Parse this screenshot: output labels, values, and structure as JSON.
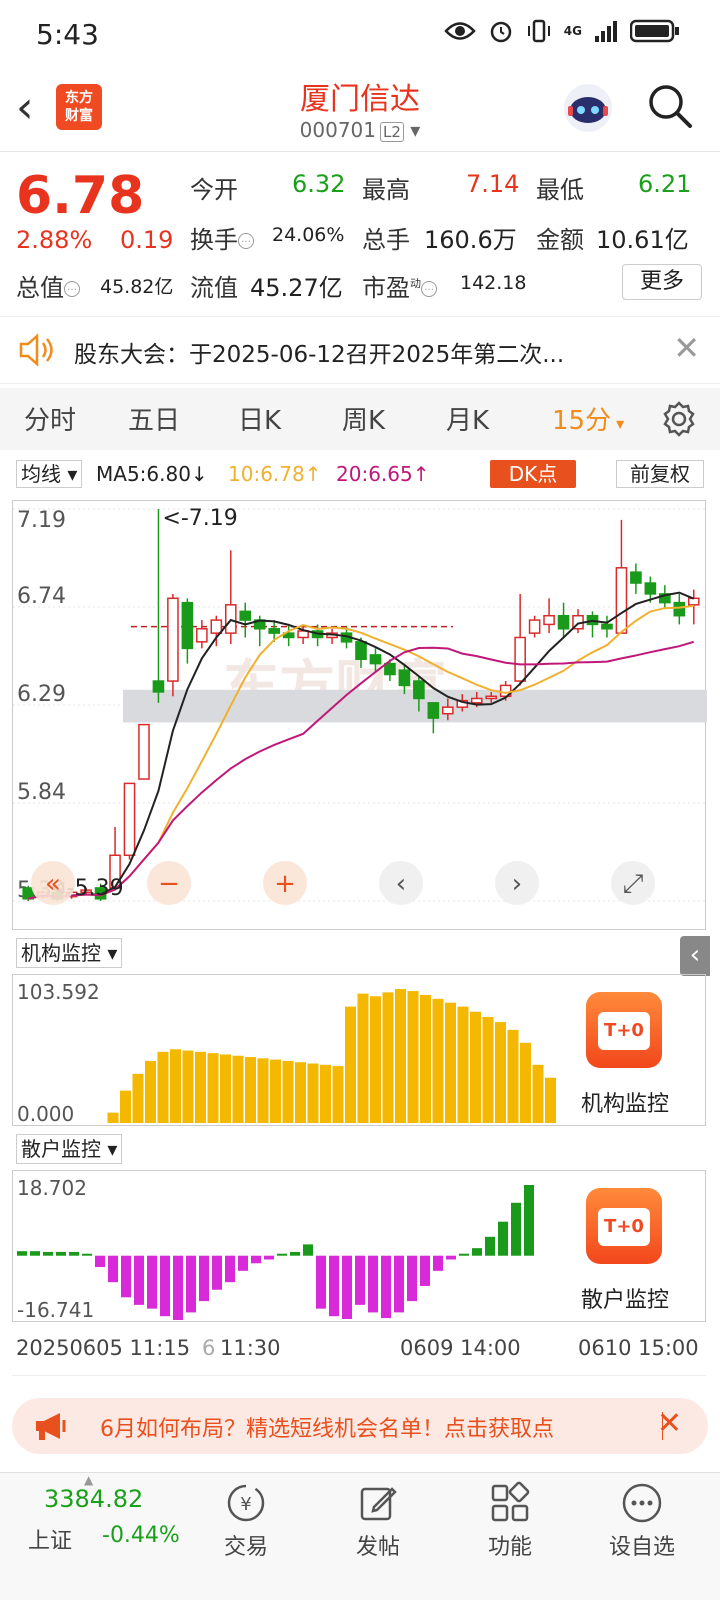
{
  "status": {
    "time": "5:43",
    "net": "4G"
  },
  "header": {
    "logo": "东方\n财富",
    "title": "厦门信达",
    "code": "000701",
    "level": "L2"
  },
  "quote": {
    "price": "6.78",
    "pct": "2.88%",
    "change": "0.19",
    "open_label": "今开",
    "open": "6.32",
    "high_label": "最高",
    "high": "7.14",
    "low_label": "最低",
    "low": "6.21",
    "turnover_label": "换手",
    "turnover": "24.06%",
    "volume_label": "总手",
    "volume": "160.6万",
    "amount_label": "金额",
    "amount": "10.61亿",
    "mcap_label": "总值",
    "mcap": "45.82亿",
    "float_label": "流值",
    "float": "45.27亿",
    "pe_label": "市盈",
    "pe_sup": "动",
    "pe": "142.18",
    "more": "更多"
  },
  "notice": {
    "text": "股东大会：于2025-06-12召开2025年第二次..."
  },
  "tabs": [
    "分时",
    "五日",
    "日K",
    "周K",
    "月K",
    "15分"
  ],
  "ma": {
    "mode": "均线",
    "ma5": "MA5:6.80↓",
    "ma10": "10:6.78↑",
    "ma20": "20:6.65↑",
    "dk": "DK点",
    "fq": "前复权"
  },
  "kline": {
    "y_labels": [
      "7.19",
      "6.74",
      "6.29",
      "5.84",
      "5.39"
    ],
    "high_marker": "<-7.19",
    "low_marker": "<-5.39",
    "watermark": "东方财富",
    "ylim": [
      5.39,
      7.19
    ],
    "candles": [
      [
        5.45,
        5.4,
        5.46,
        5.39
      ],
      [
        5.41,
        5.43,
        5.44,
        5.4
      ],
      [
        5.43,
        5.4,
        5.44,
        5.39
      ],
      [
        5.41,
        5.43,
        5.44,
        5.4
      ],
      [
        5.43,
        5.44,
        5.45,
        5.42
      ],
      [
        5.45,
        5.4,
        5.47,
        5.39
      ],
      [
        5.45,
        5.6,
        5.73,
        5.44
      ],
      [
        5.6,
        5.93,
        5.93,
        5.58
      ],
      [
        5.95,
        6.2,
        6.2,
        5.95
      ],
      [
        6.4,
        6.35,
        7.19,
        6.3
      ],
      [
        6.4,
        6.78,
        6.8,
        6.33
      ],
      [
        6.76,
        6.55,
        6.78,
        6.48
      ],
      [
        6.58,
        6.64,
        6.68,
        6.55
      ],
      [
        6.62,
        6.68,
        6.7,
        6.56
      ],
      [
        6.62,
        6.75,
        7.0,
        6.57
      ],
      [
        6.72,
        6.68,
        6.76,
        6.6
      ],
      [
        6.68,
        6.64,
        6.7,
        6.56
      ],
      [
        6.64,
        6.62,
        6.68,
        6.58
      ],
      [
        6.62,
        6.6,
        6.66,
        6.56
      ],
      [
        6.6,
        6.63,
        6.66,
        6.57
      ],
      [
        6.63,
        6.6,
        6.66,
        6.56
      ],
      [
        6.6,
        6.62,
        6.64,
        6.57
      ],
      [
        6.62,
        6.58,
        6.65,
        6.55
      ],
      [
        6.58,
        6.5,
        6.6,
        6.46
      ],
      [
        6.52,
        6.48,
        6.55,
        6.44
      ],
      [
        6.48,
        6.43,
        6.5,
        6.4
      ],
      [
        6.45,
        6.38,
        6.48,
        6.34
      ],
      [
        6.4,
        6.32,
        6.42,
        6.26
      ],
      [
        6.3,
        6.23,
        6.3,
        6.16
      ],
      [
        6.25,
        6.28,
        6.32,
        6.22
      ],
      [
        6.28,
        6.31,
        6.34,
        6.26
      ],
      [
        6.3,
        6.32,
        6.35,
        6.28
      ],
      [
        6.32,
        6.33,
        6.35,
        6.3
      ],
      [
        6.33,
        6.38,
        6.4,
        6.31
      ],
      [
        6.4,
        6.6,
        6.8,
        6.38
      ],
      [
        6.62,
        6.68,
        6.7,
        6.6
      ],
      [
        6.66,
        6.7,
        6.78,
        6.62
      ],
      [
        6.7,
        6.64,
        6.76,
        6.6
      ],
      [
        6.64,
        6.7,
        6.73,
        6.62
      ],
      [
        6.7,
        6.66,
        6.72,
        6.6
      ],
      [
        6.66,
        6.64,
        6.7,
        6.6
      ],
      [
        6.62,
        6.92,
        7.14,
        6.62
      ],
      [
        6.9,
        6.85,
        6.94,
        6.8
      ],
      [
        6.85,
        6.8,
        6.88,
        6.76
      ],
      [
        6.8,
        6.76,
        6.84,
        6.73
      ],
      [
        6.76,
        6.7,
        6.8,
        6.66
      ],
      [
        6.75,
        6.78,
        6.82,
        6.66
      ]
    ]
  },
  "inst": {
    "label": "机构监控",
    "max": "103.592",
    "min": "0.000",
    "btn": "机构监控",
    "t0": "T+0"
  },
  "retail": {
    "label": "散户监控",
    "max": "18.702",
    "min": "-16.741",
    "btn": "散户监控",
    "t0": "T+0"
  },
  "time_labels": [
    "20250605 11:15",
    "6",
    "11:30",
    "0609 14:00",
    "0610 15:00"
  ],
  "ad": {
    "text": "6月如何布局？精选短线机会名单！点击获取点"
  },
  "nav": {
    "index_value": "3384.82",
    "index_name": "上证",
    "index_pct": "-0.44%",
    "items": [
      "交易",
      "发帖",
      "功能",
      "设自选"
    ]
  }
}
